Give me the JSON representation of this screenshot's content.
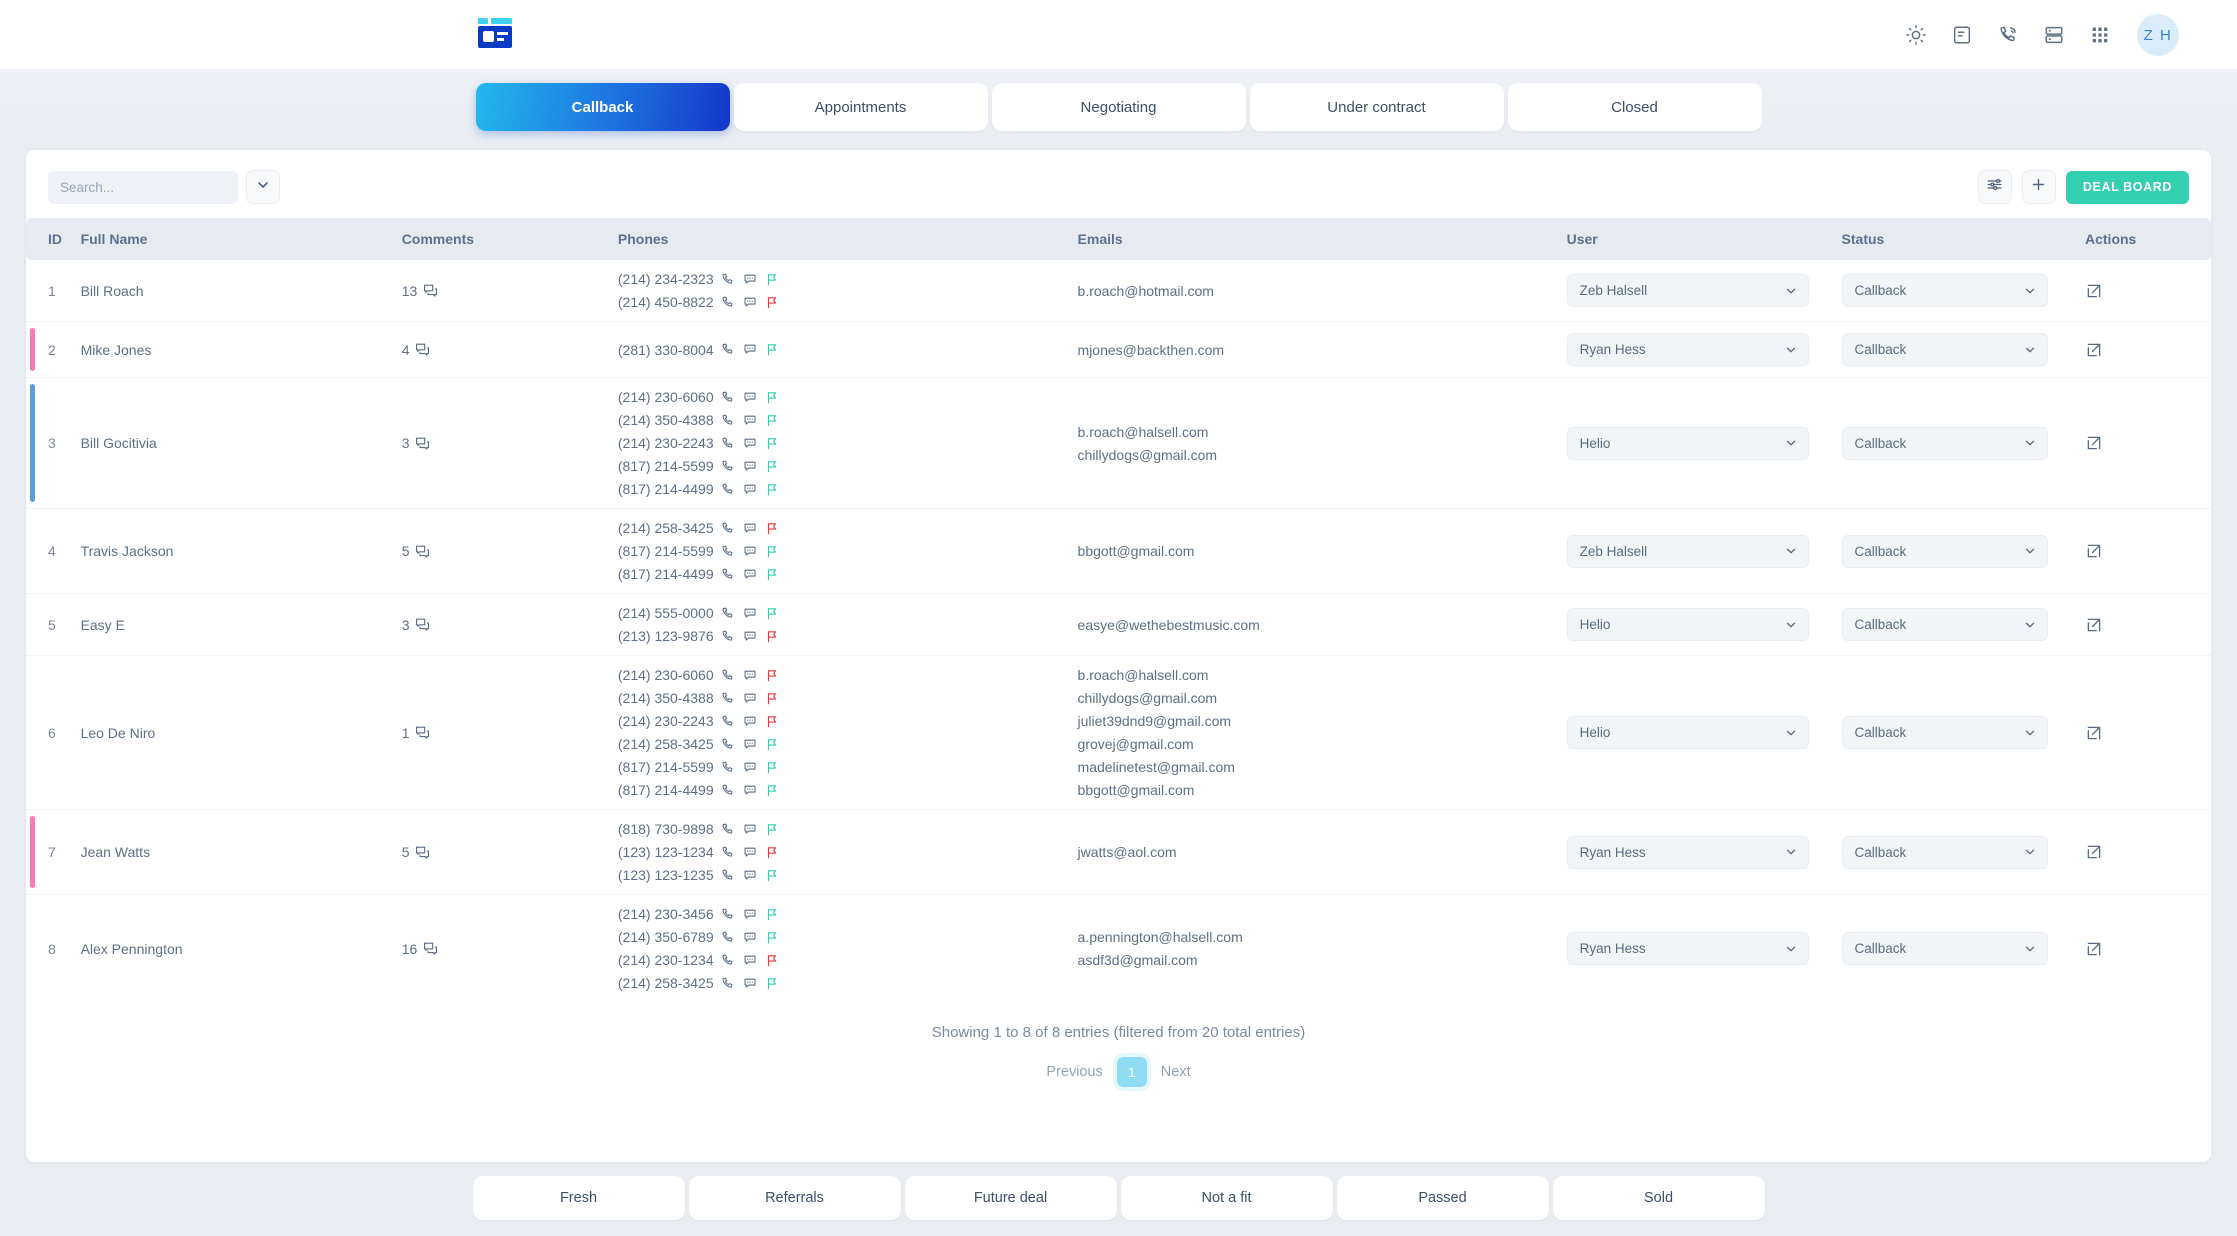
{
  "header": {
    "logo_name": "app-logo",
    "icons": [
      {
        "name": "brightness-icon",
        "label": "Brightness"
      },
      {
        "name": "note-icon",
        "label": "Notes"
      },
      {
        "name": "phone-signal-icon",
        "label": "Dialer"
      },
      {
        "name": "server-list-icon",
        "label": "Records"
      },
      {
        "name": "apps-grid-icon",
        "label": "Apps"
      }
    ],
    "avatar_initials": "Z H"
  },
  "tabs": [
    {
      "label": "Callback",
      "active": true
    },
    {
      "label": "Appointments",
      "active": false
    },
    {
      "label": "Negotiating",
      "active": false
    },
    {
      "label": "Under contract",
      "active": false
    },
    {
      "label": "Closed",
      "active": false
    }
  ],
  "toolbar": {
    "search_placeholder": "Search...",
    "search_value": "",
    "dropdown_icon": "chevron-down-icon",
    "filter_icon": "sliders-icon",
    "add_icon": "plus-icon",
    "deal_board_label": "DEAL BOARD",
    "deal_board_color": "#32cfb0"
  },
  "table": {
    "columns": [
      "ID",
      "Full Name",
      "Comments",
      "Phones",
      "Emails",
      "User",
      "Status",
      "Actions"
    ],
    "rows": [
      {
        "id": "1",
        "name": "Bill Roach",
        "comments": "13",
        "accent": "",
        "phones": [
          {
            "number": "(214) 234-2323",
            "flag": "green"
          },
          {
            "number": "(214) 450-8822",
            "flag": "red"
          }
        ],
        "emails": [
          "b.roach@hotmail.com"
        ],
        "user": "Zeb Halsell",
        "status": "Callback"
      },
      {
        "id": "2",
        "name": "Mike Jones",
        "comments": "4",
        "accent": "pink",
        "phones": [
          {
            "number": "(281) 330-8004",
            "flag": "green"
          }
        ],
        "emails": [
          "mjones@backthen.com"
        ],
        "user": "Ryan Hess",
        "status": "Callback"
      },
      {
        "id": "3",
        "name": "Bill Gocitivia",
        "comments": "3",
        "accent": "blue",
        "phones": [
          {
            "number": "(214) 230-6060",
            "flag": "green"
          },
          {
            "number": "(214) 350-4388",
            "flag": "green"
          },
          {
            "number": "(214) 230-2243",
            "flag": "green"
          },
          {
            "number": "(817) 214-5599",
            "flag": "green"
          },
          {
            "number": "(817) 214-4499",
            "flag": "green"
          }
        ],
        "emails": [
          "b.roach@halsell.com",
          "chillydogs@gmail.com"
        ],
        "user": "Helio",
        "status": "Callback"
      },
      {
        "id": "4",
        "name": "Travis Jackson",
        "comments": "5",
        "accent": "",
        "phones": [
          {
            "number": "(214) 258-3425",
            "flag": "red"
          },
          {
            "number": "(817) 214-5599",
            "flag": "green"
          },
          {
            "number": "(817) 214-4499",
            "flag": "green"
          }
        ],
        "emails": [
          "bbgott@gmail.com"
        ],
        "user": "Zeb Halsell",
        "status": "Callback"
      },
      {
        "id": "5",
        "name": "Easy E",
        "comments": "3",
        "accent": "",
        "phones": [
          {
            "number": "(214) 555-0000",
            "flag": "green"
          },
          {
            "number": "(213) 123-9876",
            "flag": "red"
          }
        ],
        "emails": [
          "easye@wethebestmusic.com"
        ],
        "user": "Helio",
        "status": "Callback"
      },
      {
        "id": "6",
        "name": "Leo De Niro",
        "comments": "1",
        "accent": "",
        "phones": [
          {
            "number": "(214) 230-6060",
            "flag": "red"
          },
          {
            "number": "(214) 350-4388",
            "flag": "red"
          },
          {
            "number": "(214) 230-2243",
            "flag": "red"
          },
          {
            "number": "(214) 258-3425",
            "flag": "green"
          },
          {
            "number": "(817) 214-5599",
            "flag": "green"
          },
          {
            "number": "(817) 214-4499",
            "flag": "green"
          }
        ],
        "emails": [
          "b.roach@halsell.com",
          "chillydogs@gmail.com",
          "juliet39dnd9@gmail.com",
          "grovej@gmail.com",
          "madelinetest@gmail.com",
          "bbgott@gmail.com"
        ],
        "user": "Helio",
        "status": "Callback"
      },
      {
        "id": "7",
        "name": "Jean Watts",
        "comments": "5",
        "accent": "pink",
        "phones": [
          {
            "number": "(818) 730-9898",
            "flag": "green"
          },
          {
            "number": "(123) 123-1234",
            "flag": "red"
          },
          {
            "number": "(123) 123-1235",
            "flag": "green"
          }
        ],
        "emails": [
          "jwatts@aol.com"
        ],
        "user": "Ryan Hess",
        "status": "Callback"
      },
      {
        "id": "8",
        "name": "Alex Pennington",
        "comments": "16",
        "accent": "",
        "phones": [
          {
            "number": "(214) 230-3456",
            "flag": "green"
          },
          {
            "number": "(214) 350-6789",
            "flag": "green"
          },
          {
            "number": "(214) 230-1234",
            "flag": "red"
          },
          {
            "number": "(214) 258-3425",
            "flag": "green"
          }
        ],
        "emails": [
          "a.pennington@halsell.com",
          "asdf3d@gmail.com"
        ],
        "user": "Ryan Hess",
        "status": "Callback"
      }
    ]
  },
  "footer": {
    "showing_text": "Showing 1 to 8 of 8 entries (filtered from 20 total entries)",
    "previous_label": "Previous",
    "current_page": "1",
    "next_label": "Next"
  },
  "bottom_tabs": [
    {
      "label": "Fresh"
    },
    {
      "label": "Referrals"
    },
    {
      "label": "Future deal"
    },
    {
      "label": "Not a fit"
    },
    {
      "label": "Passed"
    },
    {
      "label": "Sold"
    }
  ]
}
